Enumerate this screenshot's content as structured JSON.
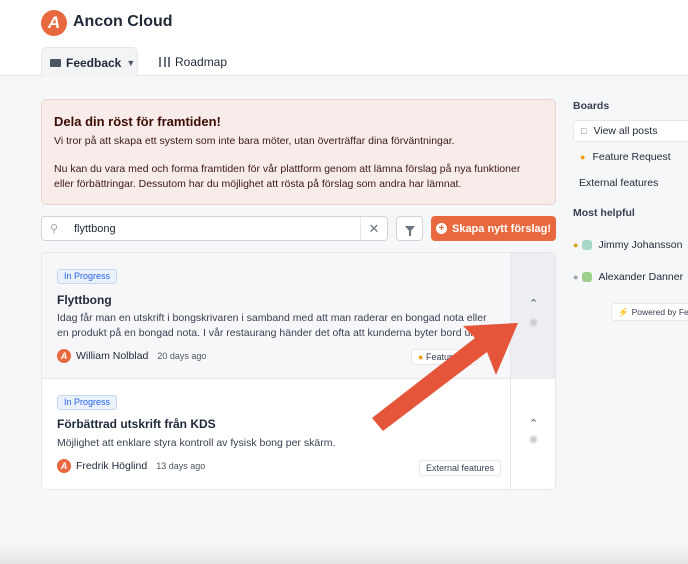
{
  "header": {
    "brand": "Ancon Cloud",
    "logo_letter": "A",
    "tabs": [
      {
        "label": "Feedback",
        "icon": "inbox-icon",
        "active": true
      },
      {
        "label": "Roadmap",
        "icon": "map-icon",
        "active": false
      }
    ]
  },
  "banner": {
    "title": "Dela din röst för framtiden!",
    "paragraph1": "Vi tror på att skapa ett system som inte bara möter, utan överträffar dina förväntningar.",
    "paragraph2": "Nu kan du vara med och forma framtiden för vår plattform genom att lämna förslag på nya funktioner eller förbättringar. Dessutom har du möjlighet att rösta på förslag som andra har lämnat."
  },
  "search": {
    "value": "flyttbong",
    "create_label": "Skapa nytt förslag!"
  },
  "posts": [
    {
      "status": "In Progress",
      "title": "Flyttbong",
      "description": "Idag får man en utskrift i bongskrivaren i samband med att man raderar en bongad nota eller en produkt på en bongad nota. I vår restaurang händer det ofta att kunderna byter bord und",
      "author": "William Nolblad",
      "time": "20 days ago",
      "tag": "Feature Re",
      "tag_icon": "lightbulb-icon"
    },
    {
      "status": "In Progress",
      "title": "Förbättrad utskrift från KDS",
      "description": "Möjlighet att enklare styra kontroll av fysisk bong per skärm.",
      "author": "Fredrik Höglind",
      "time": "13 days ago",
      "tag": "External features"
    }
  ],
  "sidebar": {
    "boards_heading": "Boards",
    "boards": [
      {
        "label": "View all posts",
        "icon": "chat-icon",
        "active": true
      },
      {
        "label": "Feature Request",
        "icon": "lightbulb-icon",
        "active": false
      },
      {
        "label": "External features",
        "icon": "",
        "active": false
      }
    ],
    "helpful_heading": "Most helpful",
    "helpful": [
      {
        "name": "Jimmy Johansson",
        "medal": "gold-medal-icon"
      },
      {
        "name": "Alexander Danner",
        "medal": "silver-medal-icon"
      }
    ],
    "powered_by": "Powered by Fe"
  },
  "colors": {
    "accent": "#e8683f",
    "banner_bg": "#f7ecea",
    "status_blue": "#2563eb",
    "annotation_arrow": "#e4553a"
  }
}
